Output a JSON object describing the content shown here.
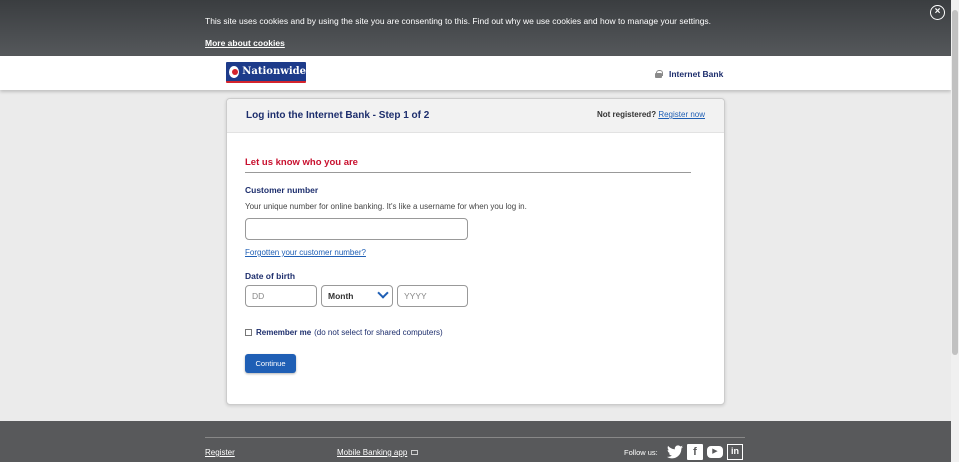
{
  "cookie_banner": {
    "text": "This site uses cookies and by using the site you are consenting to this. Find out why we use cookies and how to manage your settings.",
    "link": "More about cookies",
    "close_icon": "close-circle-icon"
  },
  "header": {
    "logo_text": "Nationwide",
    "internet_bank": "Internet Bank",
    "lock_icon": "lock-icon"
  },
  "login": {
    "title": "Log into the Internet Bank - Step 1 of 2",
    "not_registered": "Not registered?",
    "register_now": "Register now",
    "section_title": "Let us know who you are",
    "customer_number_label": "Customer number",
    "customer_number_help": "Your unique number for online banking. It's like a username for when you log in.",
    "customer_number_value": "",
    "forgotten_link": "Forgotten your customer number?",
    "dob_label": "Date of birth",
    "dd_placeholder": "DD",
    "month_selected": "Month",
    "yyyy_placeholder": "YYYY",
    "remember_label": "Remember me",
    "remember_note": "(do not select for shared computers)",
    "continue_label": "Continue"
  },
  "footer": {
    "register": "Register",
    "mobile_app": "Mobile Banking app",
    "follow_us": "Follow us:",
    "social": {
      "facebook": "f",
      "youtube": "▶",
      "linkedin": "in",
      "twitter": "🐦"
    }
  },
  "colors": {
    "brand_blue": "#1d2e6d",
    "link_blue": "#1f5fb5",
    "accent_red": "#c8102e"
  }
}
